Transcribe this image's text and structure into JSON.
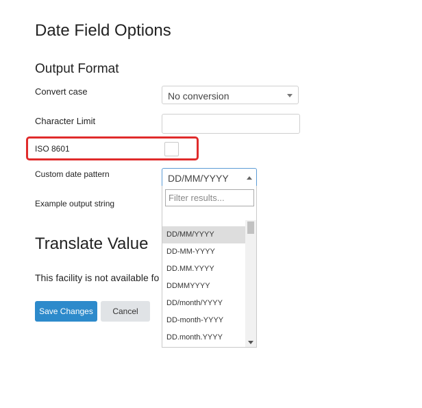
{
  "page": {
    "title": "Date Field Options",
    "output_heading": "Output Format",
    "translate_heading": "Translate Value",
    "translate_note": "This facility is not available fo"
  },
  "fields": {
    "convert_case_label": "Convert case",
    "convert_case_value": "No conversion",
    "character_limit_label": "Character Limit",
    "character_limit_value": "",
    "iso_label": "ISO 8601",
    "iso_checked": false,
    "custom_pattern_label": "Custom date pattern",
    "custom_pattern_value": "DD/MM/YYYY",
    "example_label": "Example output string"
  },
  "dropdown": {
    "filter_placeholder": "Filter results...",
    "options": [
      "DD/MM/YYYY",
      "DD-MM-YYYY",
      "DD.MM.YYYY",
      "DDMMYYYY",
      "DD/month/YYYY",
      "DD-month-YYYY",
      "DD.month.YYYY"
    ],
    "selected": "DD/MM/YYYY"
  },
  "buttons": {
    "save_label": "Save Changes",
    "cancel_label": "Cancel"
  },
  "colors": {
    "highlight": "#e02b2b",
    "primary": "#2d8acb",
    "focus_border": "#5b9bd5"
  }
}
